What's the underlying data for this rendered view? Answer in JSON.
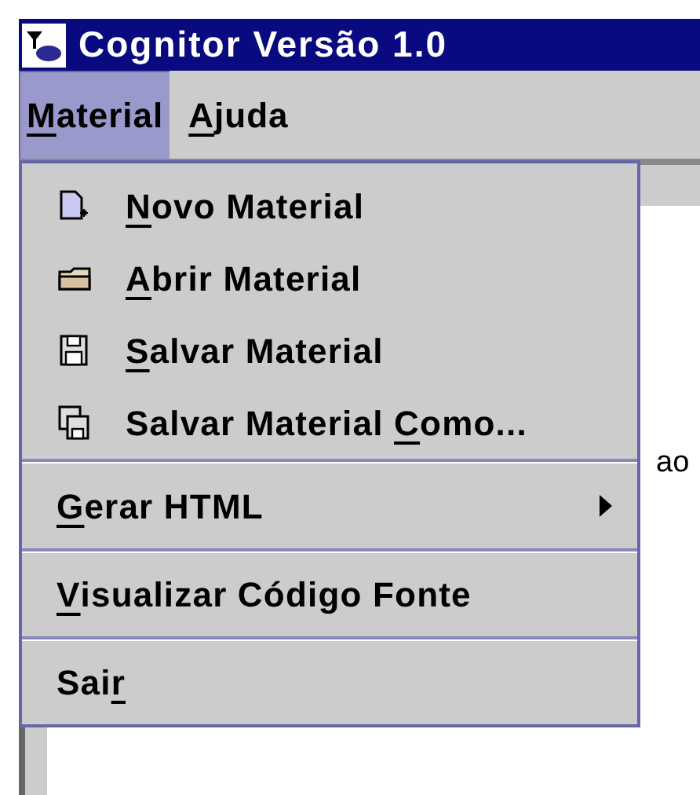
{
  "window": {
    "title": "Cognitor Versão 1.0"
  },
  "menu_bar": [
    {
      "label": {
        "key": "M",
        "after": "aterial"
      },
      "selected": true
    },
    {
      "label": {
        "key": "A",
        "after": "juda"
      },
      "selected": false
    }
  ],
  "menu": {
    "items": [
      {
        "kind": "new",
        "label": {
          "key": "N",
          "after": "ovo Material"
        }
      },
      {
        "kind": "open",
        "label": {
          "key": "A",
          "after": "brir Material"
        }
      },
      {
        "kind": "save",
        "label": {
          "key": "S",
          "after": "alvar Material"
        }
      },
      {
        "kind": "saveas",
        "label": {
          "before": "Salvar Material ",
          "key": "C",
          "after": "omo..."
        }
      },
      {
        "kind": "separator"
      },
      {
        "kind": "submenu",
        "label": {
          "key": "G",
          "after": "erar HTML"
        }
      },
      {
        "kind": "separator"
      },
      {
        "kind": "plain",
        "label": {
          "key": "V",
          "after": "isualizar Código Fonte"
        }
      },
      {
        "kind": "separator"
      },
      {
        "kind": "plain",
        "label": {
          "before": "Sai",
          "key": "r"
        }
      }
    ]
  },
  "background_text": "ao"
}
